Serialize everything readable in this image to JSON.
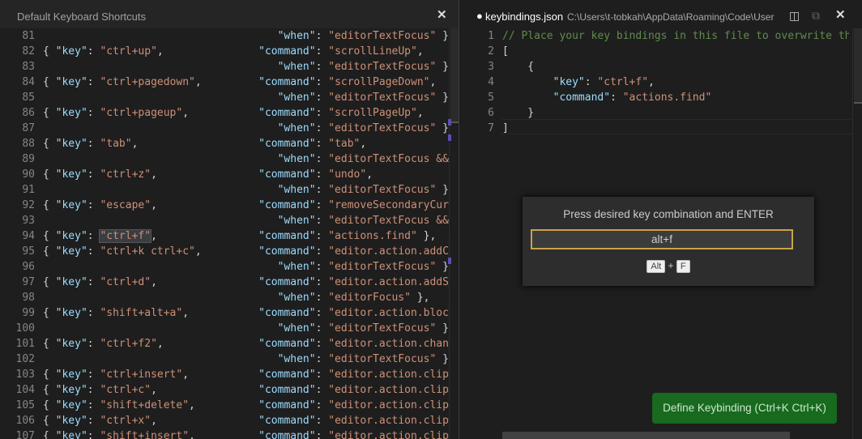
{
  "left_pane": {
    "title": "Default Keyboard Shortcuts",
    "lines": [
      {
        "n": "81",
        "when": "editorTextFocus",
        "end": " },"
      },
      {
        "n": "82",
        "key": "ctrl+up",
        "command": "scrollLineUp",
        "end": ","
      },
      {
        "n": "83",
        "when": "editorTextFocus",
        "end": " },"
      },
      {
        "n": "84",
        "key": "ctrl+pagedown",
        "command": "scrollPageDown",
        "end": ","
      },
      {
        "n": "85",
        "when": "editorTextFocus",
        "end": " },"
      },
      {
        "n": "86",
        "key": "ctrl+pageup",
        "command": "scrollPageUp",
        "end": ","
      },
      {
        "n": "87",
        "when": "editorTextFocus",
        "end": " },"
      },
      {
        "n": "88",
        "key": "tab",
        "command": "tab",
        "end": ","
      },
      {
        "n": "89",
        "when": "editorTextFocus && !e",
        "open": true
      },
      {
        "n": "90",
        "key": "ctrl+z",
        "command": "undo",
        "end": ","
      },
      {
        "n": "91",
        "when": "editorTextFocus",
        "end": " },"
      },
      {
        "n": "92",
        "key": "escape",
        "command": "removeSecondaryCursor",
        "open": true
      },
      {
        "n": "93",
        "when": "editorTextFocus && ed",
        "open": true
      },
      {
        "n": "94",
        "key": "ctrl+f",
        "command": "actions.find",
        "end": " },",
        "highlight": true
      },
      {
        "n": "95",
        "key": "ctrl+k ctrl+c",
        "command": "editor.action.addComm",
        "open": true
      },
      {
        "n": "96",
        "when": "editorTextFocus",
        "end": " },"
      },
      {
        "n": "97",
        "key": "ctrl+d",
        "command": "editor.action.addSele",
        "open": true
      },
      {
        "n": "98",
        "when": "editorFocus",
        "end": " },"
      },
      {
        "n": "99",
        "key": "shift+alt+a",
        "command": "editor.action.blockCo",
        "open": true
      },
      {
        "n": "100",
        "when": "editorTextFocus",
        "end": " },"
      },
      {
        "n": "101",
        "key": "ctrl+f2",
        "command": "editor.action.changeA",
        "open": true
      },
      {
        "n": "102",
        "when": "editorTextFocus",
        "end": " },"
      },
      {
        "n": "103",
        "key": "ctrl+insert",
        "command": "editor.action.clipboa",
        "open": true
      },
      {
        "n": "104",
        "key": "ctrl+c",
        "command": "editor.action.clipboa",
        "open": true
      },
      {
        "n": "105",
        "key": "shift+delete",
        "command": "editor.action.clipboa",
        "open": true
      },
      {
        "n": "106",
        "key": "ctrl+x",
        "command": "editor.action.clipboa",
        "open": true
      },
      {
        "n": "107",
        "key": "shift+insert",
        "command": "editor.action.clipboa",
        "open": true
      }
    ]
  },
  "right_pane": {
    "filename": "keybindings.json",
    "path": "C:\\Users\\t-tobkah\\AppData\\Roaming\\Code\\User",
    "icons": [
      "split-editor-icon",
      "open-changes-icon",
      "close-icon"
    ],
    "lines": [
      {
        "n": "1",
        "comment": "// Place your key bindings in this file to overwrite the"
      },
      {
        "n": "2",
        "punct": "["
      },
      {
        "n": "3",
        "punct": "    {"
      },
      {
        "n": "4",
        "indent": "        ",
        "prop": "\"key\"",
        "value": "\"ctrl+f\"",
        "end": ","
      },
      {
        "n": "5",
        "indent": "        ",
        "prop": "\"command\"",
        "value": "\"actions.find\"",
        "end": ""
      },
      {
        "n": "6",
        "punct": "    }"
      },
      {
        "n": "7",
        "punct": "]"
      }
    ]
  },
  "popup": {
    "message": "Press desired key combination and ENTER",
    "input_value": "alt+f",
    "keys": [
      "Alt",
      "F"
    ],
    "separator": "+"
  },
  "define_button": "Define Keybinding (Ctrl+K Ctrl+K)",
  "colors": {
    "accent_border": "#c9a24a",
    "button_bg": "#176a1e"
  }
}
